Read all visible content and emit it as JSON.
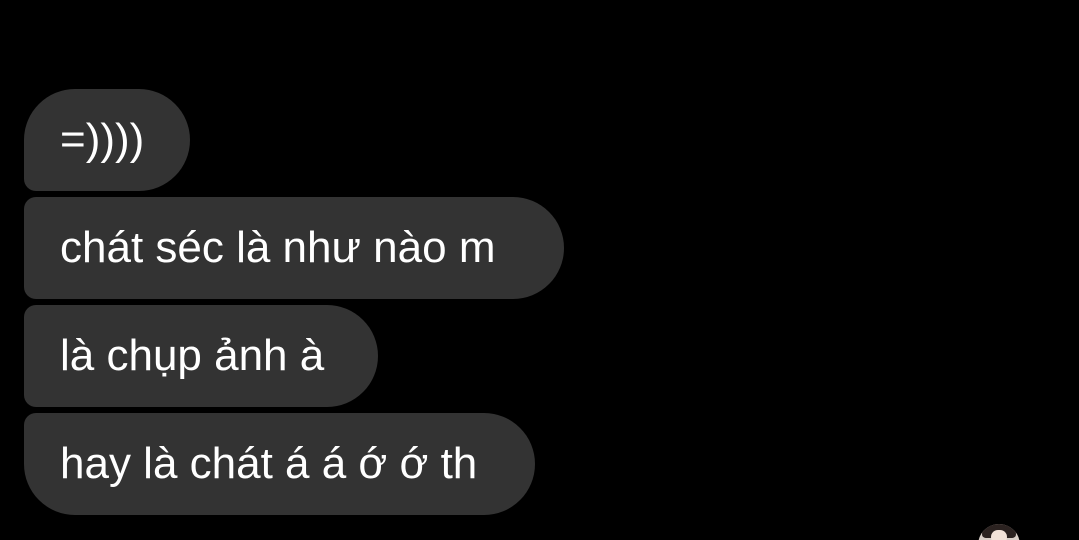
{
  "chat": {
    "messages": [
      {
        "text": "=))))"
      },
      {
        "text": "chát séc là như nào m"
      },
      {
        "text": "là chụp ảnh à"
      },
      {
        "text": "hay là chát á á ớ ớ th"
      }
    ],
    "bubble_color": "#333333",
    "background_color": "#000000",
    "text_color": "#ffffff",
    "avatar_icon": "user-avatar-photo"
  }
}
